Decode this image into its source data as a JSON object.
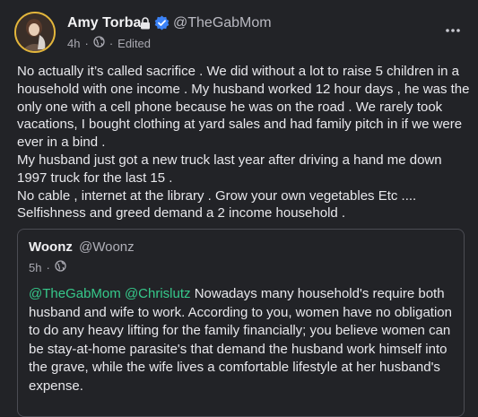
{
  "post": {
    "author_name": "Amy Torba",
    "author_handle": "@TheGabMom",
    "time": "4h",
    "edited": "Edited",
    "separator": "·",
    "paragraphs": [
      "No actually it’s called sacrifice . We did without a lot to raise 5 children in a household with one income . My husband worked 12 hour days , he was the only one with a cell phone because he was on the road . We rarely took vacations, I bought clothing at yard sales and had family pitch in if we were ever in a bind .",
      "My husband just got a new truck last year after driving a hand me down 1997 truck for the last 15 .",
      "No cable , internet at the library . Grow your own vegetables Etc ....",
      "Selfishness and greed demand a 2 income household ."
    ]
  },
  "quote": {
    "author_name": "Woonz",
    "author_handle": "@Woonz",
    "time": "5h",
    "mention_1": "@TheGabMom",
    "mention_2": "@Chrislutz",
    "body": "Nowadays many household's require both husband and wife to work. According to you, women have no obligation to do any heavy lifting for the family financially; you believe women can be stay-at-home parasite's that demand the husband work himself into the grave, while the wife lives a comfortable lifestyle at her husband's expense."
  },
  "colors": {
    "background": "#222327",
    "mention": "#36c98b",
    "verified": "#3b82f6",
    "avatar_ring": "#e3b63c"
  },
  "icons": [
    "lock-icon",
    "verified-badge-icon",
    "globe-icon",
    "more-options-icon"
  ]
}
